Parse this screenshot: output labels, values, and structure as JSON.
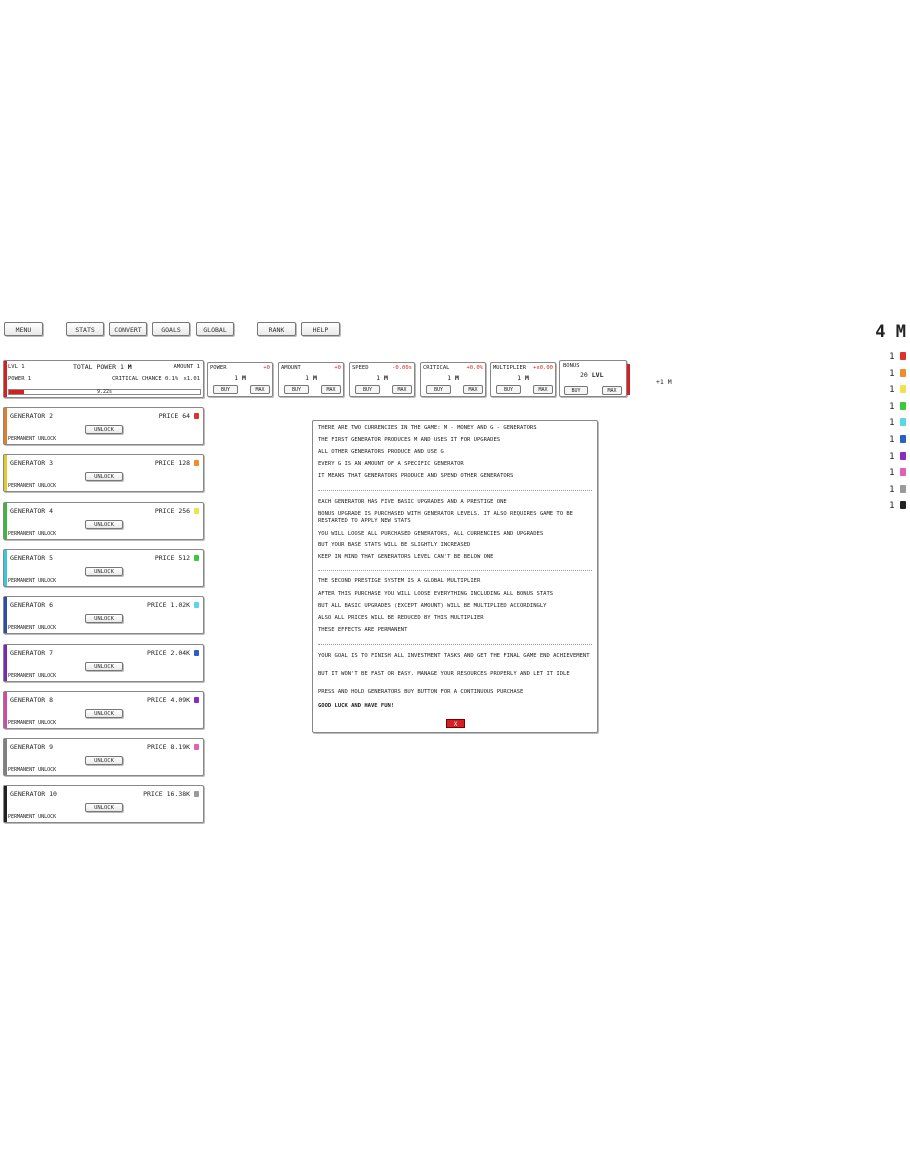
{
  "menu": {
    "menu": "MENU",
    "stats": "STATS",
    "convert": "CONVERT",
    "goals": "GOALS",
    "global": "GLOBAL",
    "rank": "RANK",
    "help": "HELP"
  },
  "gen1": {
    "level": "LVL 1",
    "total_power_label": "TOTAL POWER 1",
    "total_power_unit": "M",
    "amount": "AMOUNT 1",
    "power": "POWER 1",
    "critical_chance": "CRITICAL CHANCE 0.1%",
    "multiplier": "x1.01",
    "progress_text": "9.22s",
    "progress_fraction": 0.08
  },
  "stats_boxes": [
    {
      "label": "POWER",
      "delta": "+0",
      "value": "1",
      "unit": "M",
      "buy": "BUY",
      "max": "MAX"
    },
    {
      "label": "AMOUNT",
      "delta": "+0",
      "value": "1",
      "unit": "M",
      "buy": "BUY",
      "max": "MAX"
    },
    {
      "label": "SPEED",
      "delta": "-0.00s",
      "value": "1",
      "unit": "M",
      "buy": "BUY",
      "max": "MAX"
    },
    {
      "label": "CRITICAL",
      "delta": "+0.0%",
      "value": "1",
      "unit": "M",
      "buy": "BUY",
      "max": "MAX"
    },
    {
      "label": "MULTIPLIER",
      "delta": "+x0.00",
      "value": "1",
      "unit": "M",
      "buy": "BUY",
      "max": "MAX"
    }
  ],
  "bonus": {
    "label": "BONUS",
    "value": "20",
    "unit": "LVL",
    "buy": "BUY",
    "max": "MAX"
  },
  "income": "+1 M",
  "generators": [
    {
      "name": "GENERATOR 2",
      "price": "PRICE 64",
      "color": "#e0302c",
      "unlock": "UNLOCK",
      "perm": "PERMANENT UNLOCK"
    },
    {
      "name": "GENERATOR 3",
      "price": "PRICE 128",
      "color": "#f08c2a",
      "unlock": "UNLOCK",
      "perm": "PERMANENT UNLOCK"
    },
    {
      "name": "GENERATOR 4",
      "price": "PRICE 256",
      "color": "#f2e24a",
      "unlock": "UNLOCK",
      "perm": "PERMANENT UNLOCK"
    },
    {
      "name": "GENERATOR 5",
      "price": "PRICE 512",
      "color": "#3cc83c",
      "unlock": "UNLOCK",
      "perm": "PERMANENT UNLOCK"
    },
    {
      "name": "GENERATOR 6",
      "price": "PRICE 1.02K",
      "color": "#5ad6e8",
      "unlock": "UNLOCK",
      "perm": "PERMANENT UNLOCK"
    },
    {
      "name": "GENERATOR 7",
      "price": "PRICE 2.04K",
      "color": "#2a5ec8",
      "unlock": "UNLOCK",
      "perm": "PERMANENT UNLOCK"
    },
    {
      "name": "GENERATOR 8",
      "price": "PRICE 4.09K",
      "color": "#8a2ac0",
      "unlock": "UNLOCK",
      "perm": "PERMANENT UNLOCK"
    },
    {
      "name": "GENERATOR 9",
      "price": "PRICE 8.19K",
      "color": "#e060b8",
      "unlock": "UNLOCK",
      "perm": "PERMANENT UNLOCK"
    },
    {
      "name": "GENERATOR 10",
      "price": "PRICE 16.38K",
      "color": "#9a9a9a",
      "unlock": "UNLOCK",
      "perm": "PERMANENT UNLOCK"
    }
  ],
  "gen_bar_colors": [
    "#e07f2a",
    "#e4c830",
    "#3cb83c",
    "#3cc8d8",
    "#2a4ea8",
    "#7a2ab0",
    "#d04aa8",
    "#808080",
    "#222222"
  ],
  "help": {
    "lines": [
      "THERE ARE TWO CURRENCIES IN THE GAME: M - MONEY AND G - GENERATORS",
      "THE FIRST GENERATOR PRODUCES M AND USES IT FOR UPGRADES",
      "ALL OTHER GENERATORS PRODUCE AND USE G",
      "EVERY G IS AN AMOUNT OF A SPECIFIC GENERATOR",
      "IT MEANS THAT GENERATORS PRODUCE AND SPEND OTHER GENERATORS",
      "EACH GENERATOR HAS FIVE BASIC UPGRADES AND A PRESTIGE ONE",
      "BONUS UPGRADE IS PURCHASED WITH GENERATOR LEVELS. IT ALSO REQUIRES GAME TO BE RESTARTED TO APPLY NEW STATS",
      "YOU WILL LOOSE ALL PURCHASED GENERATORS, ALL CURRENCIES AND UPGRADES",
      "BUT YOUR BASE STATS WILL BE SLIGHTLY INCREASED",
      "KEEP IN MIND THAT GENERATORS LEVEL CAN'T BE BELOW ONE",
      "THE SECOND PRESTIGE SYSTEM IS A GLOBAL MULTIPLIER",
      "AFTER THIS PURCHASE YOU WILL LOOSE EVERYTHING INCLUDING ALL BONUS STATS",
      "BUT ALL BASIC UPGRADES (EXCEPT AMOUNT) WILL BE MULTIPLIED ACCORDINGLY",
      "ALSO ALL PRICES WILL BE REDUCED BY THIS MULTIPLIER",
      "THESE EFFECTS ARE PERMANENT",
      "YOUR GOAL IS TO FINISH ALL INVESTMENT TASKS AND GET THE FINAL GAME END ACHIEVEMENT",
      "BUT IT WON'T BE FAST OR EASY. MANAGE YOUR RESOURCES PROPERLY AND LET IT IDLE",
      "PRESS AND HOLD GENERATORS BUY BUTTON FOR A CONTINUOUS PURCHASE",
      "GOOD LUCK AND HAVE FUN!"
    ],
    "separator": "=====================================================================",
    "close": "X"
  },
  "money": {
    "value": "4",
    "unit": "M"
  },
  "currencies": [
    {
      "value": "1",
      "color": "#e0302c"
    },
    {
      "value": "1",
      "color": "#f08c2a"
    },
    {
      "value": "1",
      "color": "#f2e24a"
    },
    {
      "value": "1",
      "color": "#3cc83c"
    },
    {
      "value": "1",
      "color": "#5ad6e8"
    },
    {
      "value": "1",
      "color": "#2a5ec8"
    },
    {
      "value": "1",
      "color": "#8a2ac0"
    },
    {
      "value": "1",
      "color": "#e060b8"
    },
    {
      "value": "1",
      "color": "#9a9a9a"
    },
    {
      "value": "1",
      "color": "#222222"
    }
  ]
}
